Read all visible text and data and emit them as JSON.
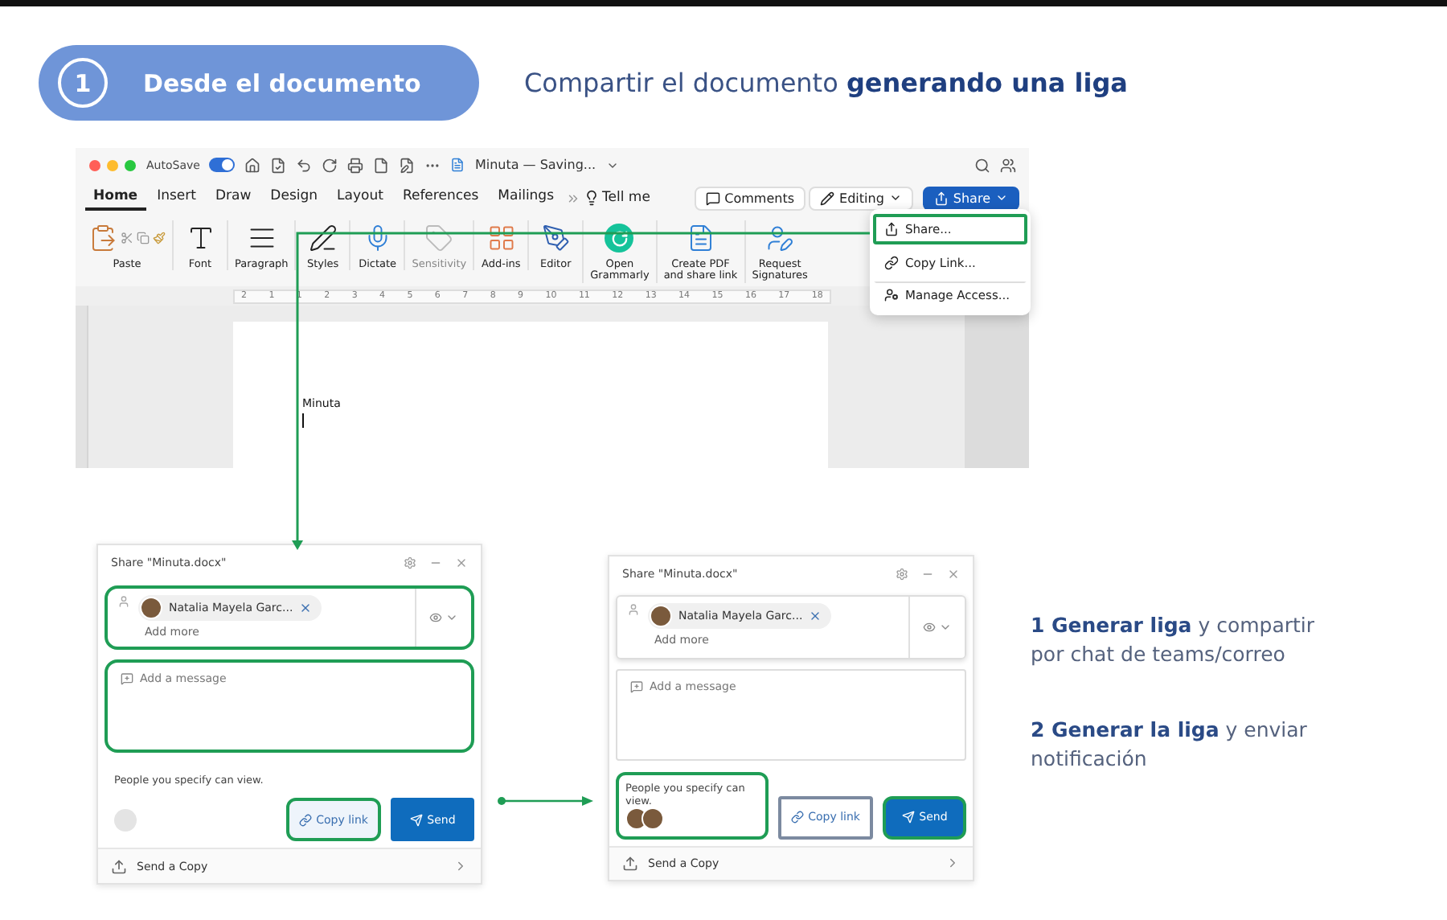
{
  "step": {
    "number": "1",
    "label": "Desde el documento"
  },
  "heading": "Compartir el documento **generando una liga**",
  "word_window": {
    "autosave_label": "AutoSave",
    "autosave_on": true,
    "doc_title": "Minuta — Saving...",
    "tabs": [
      {
        "label": "Home",
        "selected": true
      },
      {
        "label": "Insert",
        "selected": false
      },
      {
        "label": "Draw",
        "selected": false
      },
      {
        "label": "Design",
        "selected": false
      },
      {
        "label": "Layout",
        "selected": false
      },
      {
        "label": "References",
        "selected": false
      },
      {
        "label": "Mailings",
        "selected": false
      }
    ],
    "tell_me": "Tell me",
    "comments": "Comments",
    "editing": "Editing",
    "share": "Share",
    "ribbon": [
      {
        "kind": "paste",
        "label": "Paste",
        "disabled": false
      },
      {
        "kind": "font",
        "label": "Font",
        "disabled": false
      },
      {
        "kind": "paragraph",
        "label": "Paragraph",
        "disabled": false
      },
      {
        "kind": "styles",
        "label": "Styles",
        "disabled": false
      },
      {
        "kind": "dictate",
        "label": "Dictate",
        "disabled": false
      },
      {
        "kind": "sensitivity",
        "label": "Sensitivity",
        "disabled": true
      },
      {
        "kind": "addins",
        "label": "Add-ins",
        "disabled": false
      },
      {
        "kind": "editor",
        "label": "Editor",
        "disabled": false
      },
      {
        "kind": "grammarly",
        "label": "Open\nGrammarly",
        "disabled": false
      },
      {
        "kind": "pdf",
        "label": "Create PDF\nand share link",
        "disabled": false
      },
      {
        "kind": "signatures",
        "label": "Request\nSignatures",
        "disabled": false
      }
    ],
    "ruler": [
      "2",
      "1",
      "1",
      "2",
      "3",
      "4",
      "5",
      "6",
      "7",
      "8",
      "9",
      "10",
      "11",
      "12",
      "13",
      "14",
      "15",
      "16",
      "17",
      "18"
    ],
    "document_text": "Minuta",
    "share_menu": [
      {
        "kind": "share",
        "label": "Share...",
        "highlighted": true
      },
      {
        "kind": "link",
        "label": "Copy Link...",
        "highlighted": false
      },
      {
        "kind": "access",
        "label": "Manage Access...",
        "highlighted": false
      }
    ]
  },
  "dialogs": [
    {
      "title": "Share \"Minuta.docx\"",
      "recipient": "Natalia Mayela Garc...",
      "add_more_placeholder": "Add more",
      "message_placeholder": "Add a message",
      "permission_note": "People you specify can view.",
      "copy_link": "Copy link",
      "send": "Send",
      "send_copy": "Send a Copy",
      "viewers": [
        {
          "kind": "placeholder"
        }
      ],
      "recipients_highlighted": true,
      "message_highlighted": true,
      "people_highlighted": false,
      "copy_link_highlighted": true,
      "send_highlighted": false,
      "copy_link_focused": false
    },
    {
      "title": "Share \"Minuta.docx\"",
      "recipient": "Natalia Mayela Garc...",
      "add_more_placeholder": "Add more",
      "message_placeholder": "Add a message",
      "permission_note": "People you specify can view.",
      "copy_link": "Copy link",
      "send": "Send",
      "send_copy": "Send a Copy",
      "viewers": [
        {
          "kind": "avatar"
        },
        {
          "kind": "avatar"
        }
      ],
      "recipients_highlighted": false,
      "message_highlighted": false,
      "people_highlighted": true,
      "copy_link_highlighted": false,
      "send_highlighted": true,
      "copy_link_focused": true
    }
  ],
  "notes": [
    "**1 Generar liga** y compartir por chat de teams/correo",
    "**2 Generar la liga** y enviar notificación"
  ]
}
